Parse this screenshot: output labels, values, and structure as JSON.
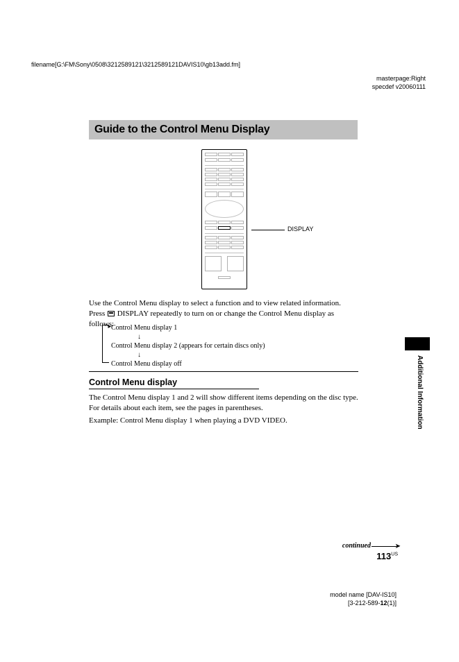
{
  "header": {
    "filename": "filename[G:\\FM\\Sony\\0508\\3212589121\\3212589121DAVIS10\\gb13add.fm]",
    "masterpage": "masterpage:Right",
    "specdef": "specdef v20060111"
  },
  "title": "Guide to the Control Menu Display",
  "remote": {
    "callout": "DISPLAY"
  },
  "intro": "Use the Control Menu display to select a function and to view related information. Press     DISPLAY repeatedly to turn on or change the Control Menu display as follows:",
  "cycle": {
    "line1": "Control Menu display 1",
    "line2": "Control Menu display 2 (appears for certain discs only)",
    "line3": "Control Menu display off"
  },
  "subheading": "Control Menu display",
  "para1": "The Control Menu display 1 and 2 will show different items depending on the disc type. For details about each item, see the pages in parentheses.",
  "para2": "Example: Control Menu display 1 when playing a DVD VIDEO.",
  "side_tab_label": "Additional Information",
  "continued": "continued",
  "page_number": "113",
  "page_region": "US",
  "footer": {
    "model": "model name [DAV-IS10]",
    "partno_pre": "[3-212-589-",
    "partno_bold": "12",
    "partno_post": "(1)]"
  }
}
